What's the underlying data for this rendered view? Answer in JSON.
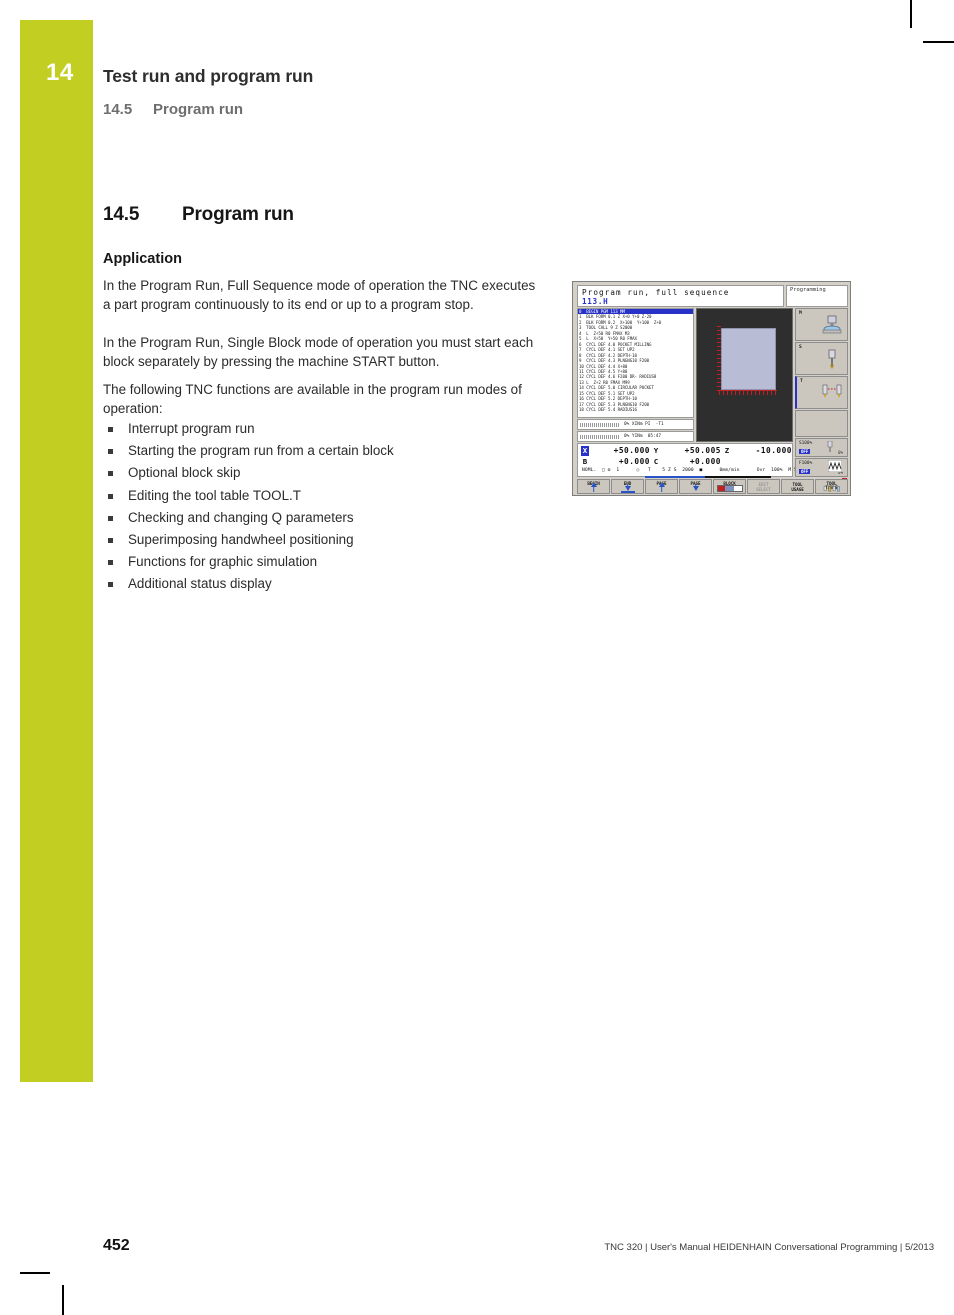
{
  "running_head": {
    "chapter_number": "14",
    "chapter_title": "Test run and program run",
    "section_number": "14.5",
    "section_title": "Program run",
    "accent_color": "#c2ce22"
  },
  "section": {
    "number": "14.5",
    "title": "Program run",
    "subhead": "Application",
    "paragraphs": [
      "In the Program Run, Full Sequence mode of operation the TNC executes a part program continuously to its end or up to a program stop.",
      "In the Program Run, Single Block mode of operation you must start each block separately by pressing the machine START button.",
      "The following TNC functions are available in the program run modes of operation:"
    ],
    "bullets": [
      "Interrupt program run",
      "Starting the program run from a certain block",
      "Optional block skip",
      "Editing the tool table TOOL.T",
      "Checking and changing Q parameters",
      "Superimposing handwheel positioning",
      "Functions for graphic simulation",
      "Additional status display"
    ]
  },
  "footer": {
    "page_number": "452",
    "text": "TNC 320 | User's Manual HEIDENHAIN Conversational Programming | 5/2013"
  },
  "tnc_screen": {
    "mode_title": "Program run, full sequence",
    "program_name": "113.H",
    "secondary_mode": "Programming",
    "nc_blocks": [
      "0  BEGIN PGM 113 MM",
      "1  BLK FORM 0.1 Z X+0 Y+0 Z-20",
      "2  BLK FORM 0.2  X+100  Y+100  Z+0",
      "3  TOOL CALL 9 Z S2000",
      "4  L  Z+50 R0 FMAX M3",
      "5  L  X+50  Y+50 R0 FMAX",
      "6  CYCL DEF 4.0 POCKET MILLING",
      "7  CYCL DEF 4.1 SET UP2",
      "8  CYCL DEF 4.2 DEPTH-10",
      "9  CYCL DEF 4.3 PLNGNG10 F200",
      "10 CYCL DEF 4.4 X+80",
      "11 CYCL DEF 4.5 Y+80",
      "12 CYCL DEF 4.6 F200 DR- RADIUS8",
      "13 L  Z+2 R0 FMAX M99",
      "14 CYCL DEF 5.0 CIRCULAR POCKET",
      "15 CYCL DEF 5.1 SET UP2",
      "16 CYCL DEF 5.2 DEPTH-10",
      "17 CYCL DEF 5.3 PLNGNG10 F200",
      "18 CYCL DEF 5.4 RADIUS16"
    ],
    "strips": [
      "0% XINm PI  -T1",
      "0% YINm  05:47"
    ],
    "dro": {
      "rows": [
        [
          {
            "axis": "X",
            "value": "+50.000",
            "highlight": true
          },
          {
            "axis": "Y",
            "value": "+50.005",
            "highlight": false
          },
          {
            "axis": "Z",
            "value": "-10.000",
            "highlight": false
          }
        ],
        [
          {
            "axis": "B",
            "value": "+0.000",
            "highlight": false
          },
          {
            "axis": "C",
            "value": "+0.000",
            "highlight": false
          }
        ]
      ],
      "status_line": "NOML.  □ ⚙  1      ○   T    5 Z S  2000  ■      0mm/min      Ovr  100%  M 5/9"
    },
    "side_panels": [
      {
        "label": "M",
        "icon": "machine-icon"
      },
      {
        "label": "S",
        "icon": "spindle-icon"
      },
      {
        "label": "T",
        "icon": "tool-icon"
      }
    ],
    "overrides": [
      {
        "label": "S100%",
        "state": "OFF",
        "pct": "0%",
        "icon": "spindle-override-icon"
      },
      {
        "label": "F100%",
        "state": "OFF",
        "pct": "0%",
        "icon": "feed-override-icon"
      }
    ],
    "softkeys": [
      {
        "label": "BEGIN",
        "icon": "arrow-up-icon",
        "disabled": false
      },
      {
        "label": "END",
        "icon": "arrow-down-icon",
        "disabled": false
      },
      {
        "label": "PAGE",
        "icon": "arrow-up-icon",
        "disabled": false
      },
      {
        "label": "PAGE",
        "icon": "arrow-down-icon",
        "disabled": false
      },
      {
        "label": "BLOCK\nSCAN",
        "icon": "block-scan-icon",
        "disabled": false
      },
      {
        "label": "EDIT\nSELECT",
        "icon": "",
        "disabled": true
      },
      {
        "label": "TOOL\nUSAGE",
        "icon": "",
        "disabled": false
      },
      {
        "label": "TOOL\nTABLE",
        "icon": "tool-table-icon",
        "disabled": false
      }
    ]
  }
}
